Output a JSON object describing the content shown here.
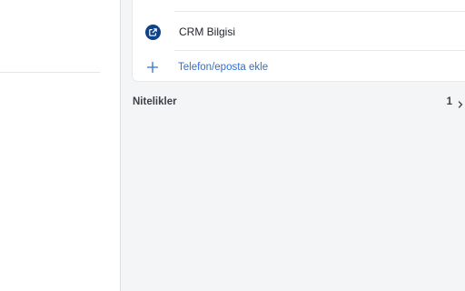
{
  "card": {
    "crm_label": "CRM Bilgisi",
    "add_contact_label": "Telefon/eposta ekle"
  },
  "attributes": {
    "title": "Nitelikler",
    "count": "1"
  },
  "icons": {
    "crm": "external-link-icon",
    "add": "plus-icon",
    "chevron": "chevron-right-icon"
  },
  "colors": {
    "accent": "#2e6fd6",
    "crm_icon": "#10428a",
    "pane_bg": "#f4f5f7"
  }
}
